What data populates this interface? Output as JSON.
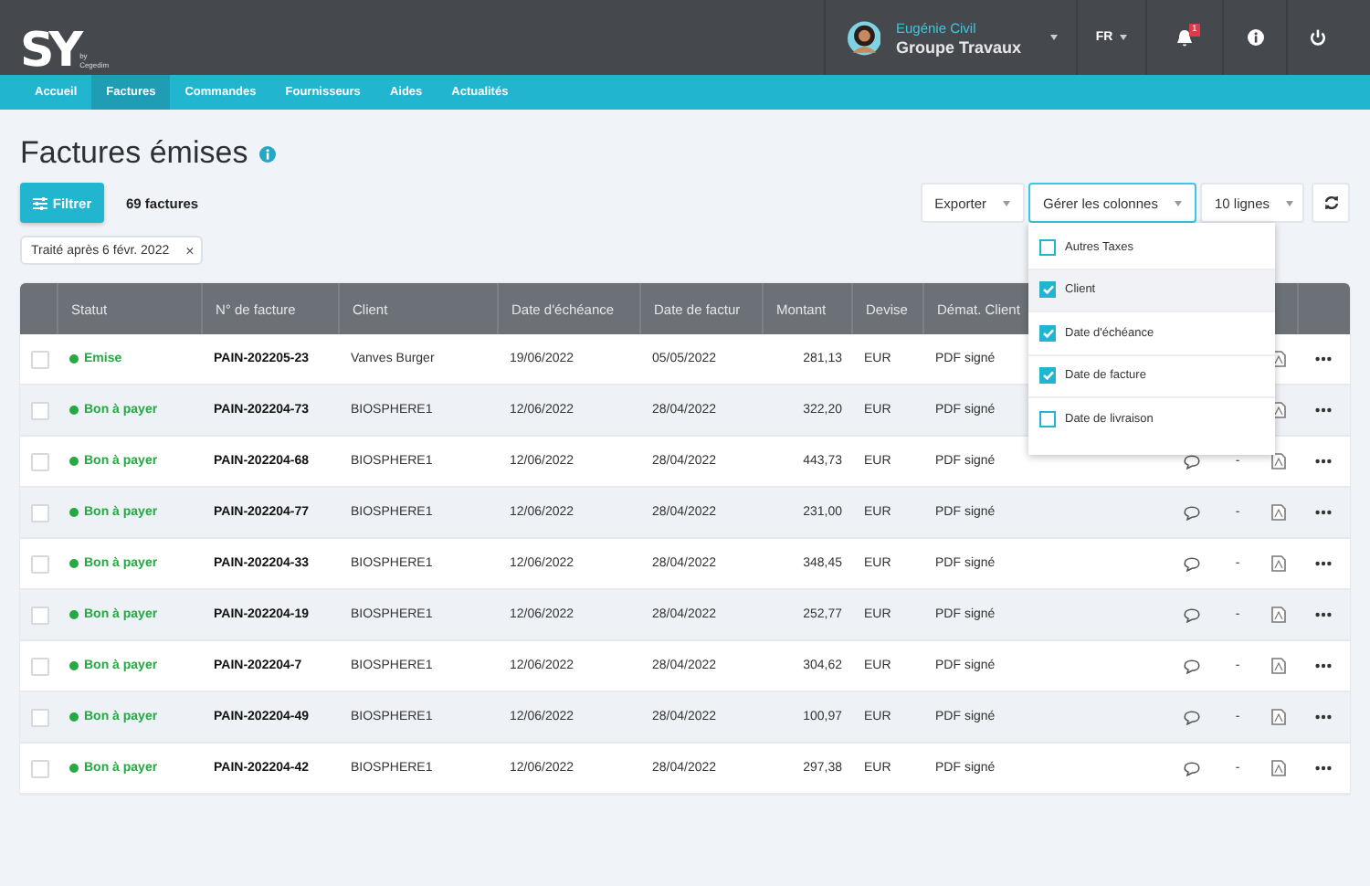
{
  "header": {
    "logo": "SY",
    "logo_by": "by",
    "logo_brand": "Cegedim",
    "user_name": "Eugénie Civil",
    "company": "Groupe Travaux",
    "language": "FR",
    "notifications": "1"
  },
  "nav": [
    {
      "label": "Accueil",
      "selected": false
    },
    {
      "label": "Factures",
      "selected": true
    },
    {
      "label": "Commandes",
      "selected": false
    },
    {
      "label": "Fournisseurs",
      "selected": false
    },
    {
      "label": "Aides",
      "selected": false
    },
    {
      "label": "Actualités",
      "selected": false
    }
  ],
  "page": {
    "title": "Factures émises"
  },
  "toolbar": {
    "filter_button": "Filtrer",
    "count": "69 factures",
    "export": "Exporter",
    "columns": "Gérer les colonnes",
    "columns_open": true,
    "page_size": "10 lignes"
  },
  "filters": [
    {
      "label": "Traité après 6 févr. 2022",
      "remove": "×"
    }
  ],
  "columns_menu": [
    {
      "label": "Autres Taxes",
      "checked": false,
      "selected": false
    },
    {
      "label": "Client",
      "checked": true,
      "selected": true
    },
    {
      "label": "Date d'échéance",
      "checked": true,
      "selected": false
    },
    {
      "label": "Date de facture",
      "checked": true,
      "selected": false
    },
    {
      "label": "Date de livraison",
      "checked": false,
      "selected": false
    }
  ],
  "table": {
    "columns": [
      "Statut",
      "N° de facture",
      "Client",
      "Date d'échéance",
      "Date de factur",
      "Montant",
      "Devise",
      "Démat. Client"
    ],
    "rows": [
      {
        "checked": false,
        "status": "Emise",
        "number": "PAIN-202205-23",
        "client": "Vanves Burger",
        "due": "19/06/2022",
        "date": "05/05/2022",
        "amount": "281,13",
        "currency": "EUR",
        "demat": "PDF signé"
      },
      {
        "checked": false,
        "status": "Bon à payer",
        "number": "PAIN-202204-73",
        "client": "BIOSPHERE1",
        "due": "12/06/2022",
        "date": "28/04/2022",
        "amount": "322,20",
        "currency": "EUR",
        "demat": "PDF signé"
      },
      {
        "checked": false,
        "status": "Bon à payer",
        "number": "PAIN-202204-68",
        "client": "BIOSPHERE1",
        "due": "12/06/2022",
        "date": "28/04/2022",
        "amount": "443,73",
        "currency": "EUR",
        "demat": "PDF signé",
        "column_10": "-"
      },
      {
        "checked": false,
        "status": "Bon à payer",
        "number": "PAIN-202204-77",
        "client": "BIOSPHERE1",
        "due": "12/06/2022",
        "date": "28/04/2022",
        "amount": "231,00",
        "currency": "EUR",
        "demat": "PDF signé",
        "column_10": "-"
      },
      {
        "checked": false,
        "status": "Bon à payer",
        "number": "PAIN-202204-33",
        "client": "BIOSPHERE1",
        "due": "12/06/2022",
        "date": "28/04/2022",
        "amount": "348,45",
        "currency": "EUR",
        "demat": "PDF signé",
        "column_10": "-"
      },
      {
        "checked": false,
        "status": "Bon à payer",
        "number": "PAIN-202204-19",
        "client": "BIOSPHERE1",
        "due": "12/06/2022",
        "date": "28/04/2022",
        "amount": "252,77",
        "currency": "EUR",
        "demat": "PDF signé",
        "column_10": "-"
      },
      {
        "checked": false,
        "status": "Bon à payer",
        "number": "PAIN-202204-7",
        "client": "BIOSPHERE1",
        "due": "12/06/2022",
        "date": "28/04/2022",
        "amount": "304,62",
        "currency": "EUR",
        "demat": "PDF signé",
        "column_10": "-"
      },
      {
        "checked": false,
        "status": "Bon à payer",
        "number": "PAIN-202204-49",
        "client": "BIOSPHERE1",
        "due": "12/06/2022",
        "date": "28/04/2022",
        "amount": "100,97",
        "currency": "EUR",
        "demat": "PDF signé",
        "column_10": "-"
      },
      {
        "checked": false,
        "status": "Bon à payer",
        "number": "PAIN-202204-42",
        "client": "BIOSPHERE1",
        "due": "12/06/2022",
        "date": "28/04/2022",
        "amount": "297,38",
        "currency": "EUR",
        "demat": "PDF signé",
        "column_10": "-"
      }
    ]
  }
}
